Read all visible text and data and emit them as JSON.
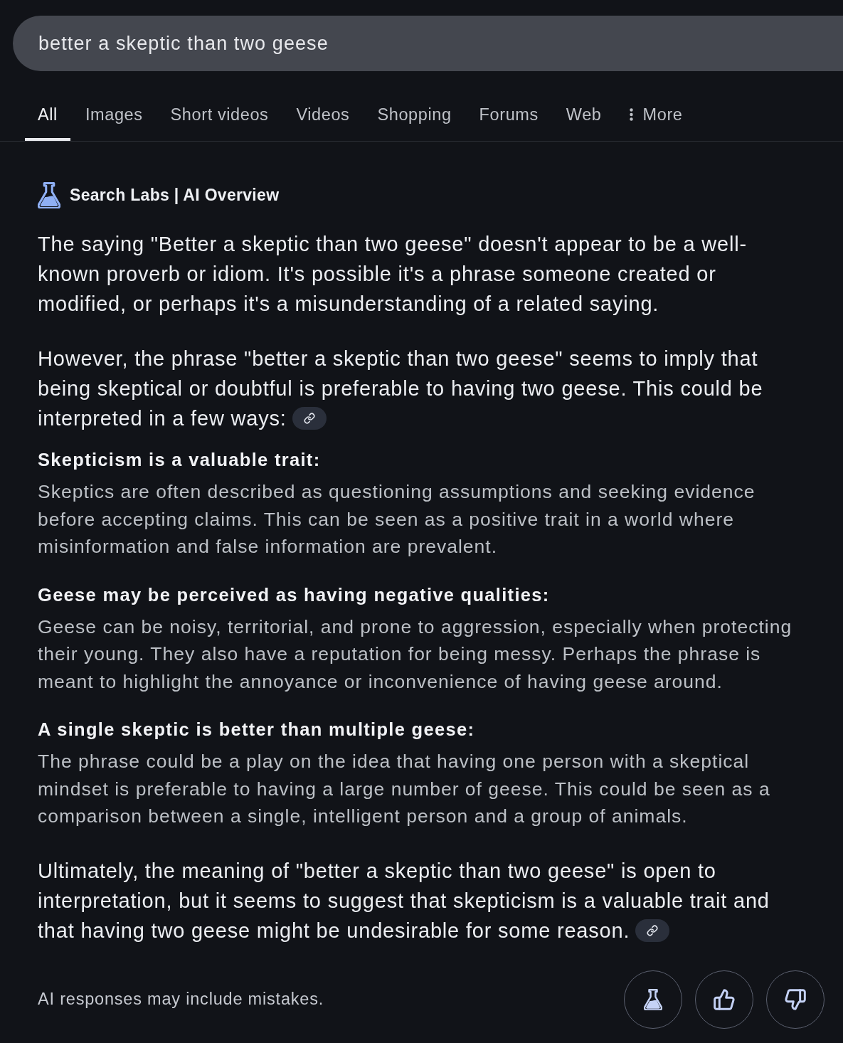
{
  "search": {
    "query": "better a skeptic than two geese"
  },
  "tabs": [
    {
      "label": "All",
      "selected": true,
      "kind": "link"
    },
    {
      "label": "Images",
      "selected": false,
      "kind": "link"
    },
    {
      "label": "Short videos",
      "selected": false,
      "kind": "link"
    },
    {
      "label": "Videos",
      "selected": false,
      "kind": "link"
    },
    {
      "label": "Shopping",
      "selected": false,
      "kind": "link"
    },
    {
      "label": "Forums",
      "selected": false,
      "kind": "link"
    },
    {
      "label": "Web",
      "selected": false,
      "kind": "link"
    },
    {
      "label": "More",
      "selected": false,
      "kind": "menu"
    }
  ],
  "ai_overview": {
    "header": "Search Labs | AI Overview",
    "blocks": [
      {
        "kind": "paragraph",
        "text": "The saying \"Better a skeptic than two geese\" doesn't appear to be a well-known proverb or idiom. It's possible it's a phrase someone created or modified, or perhaps it's a misunderstanding of a related saying.",
        "source_link": false
      },
      {
        "kind": "paragraph",
        "text": "However, the phrase \"better a skeptic than two geese\" seems to imply that being skeptical or doubtful is preferable to having two geese. This could be interpreted in a few ways:",
        "source_link": true
      },
      {
        "kind": "point",
        "heading": "Skepticism is a valuable trait:",
        "text": "Skeptics are often described as questioning assumptions and seeking evidence before accepting claims. This can be seen as a positive trait in a world where misinformation and false information are prevalent."
      },
      {
        "kind": "point",
        "heading": "Geese may be perceived as having negative qualities:",
        "text": "Geese can be noisy, territorial, and prone to aggression, especially when protecting their young. They also have a reputation for being messy. Perhaps the phrase is meant to highlight the annoyance or inconvenience of having geese around."
      },
      {
        "kind": "point",
        "heading": "A single skeptic is better than multiple geese:",
        "text": "The phrase could be a play on the idea that having one person with a skeptical mindset is preferable to having a large number of geese. This could be seen as a comparison between a single, intelligent person and a group of animals."
      },
      {
        "kind": "paragraph",
        "text": "Ultimately, the meaning of \"better a skeptic than two geese\" is open to interpretation, but it seems to suggest that skepticism is a valuable trait and that having two geese might be undesirable for some reason.",
        "source_link": true
      }
    ]
  },
  "footer": {
    "disclaimer": "AI responses may include mistakes.",
    "buttons": [
      {
        "kind": "labs"
      },
      {
        "kind": "thumbs_up"
      },
      {
        "kind": "thumbs_down"
      }
    ]
  }
}
